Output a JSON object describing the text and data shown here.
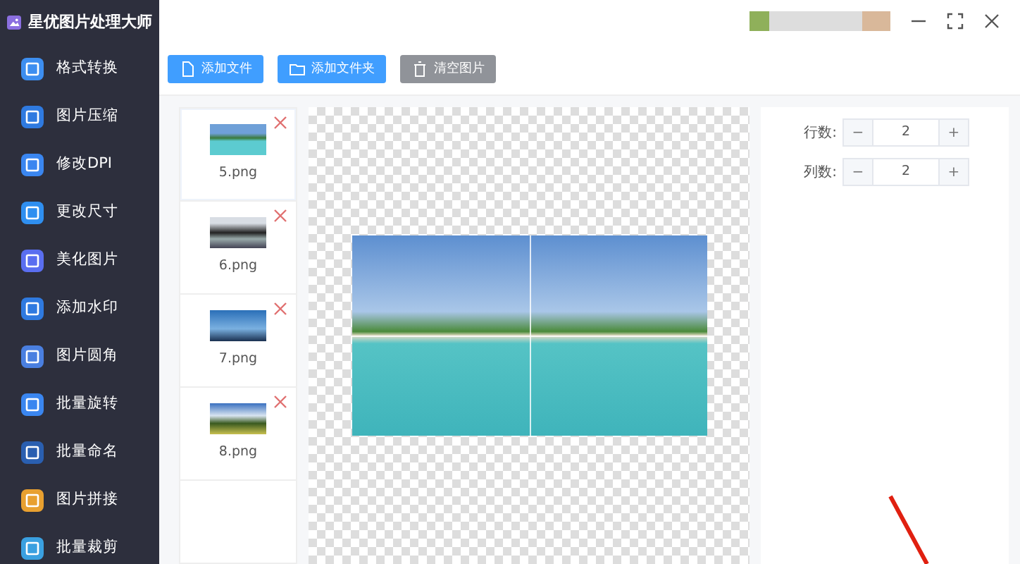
{
  "app": {
    "title": "星优图片处理大师"
  },
  "sidebar": {
    "items": [
      {
        "label": "格式转换",
        "selected": false
      },
      {
        "label": "图片压缩",
        "selected": false
      },
      {
        "label": "修改DPI",
        "selected": false
      },
      {
        "label": "更改尺寸",
        "selected": false
      },
      {
        "label": "美化图片",
        "selected": false
      },
      {
        "label": "添加水印",
        "selected": false
      },
      {
        "label": "图片圆角",
        "selected": false
      },
      {
        "label": "批量旋转",
        "selected": false
      },
      {
        "label": "批量命名",
        "selected": false
      },
      {
        "label": "图片拼接",
        "selected": false
      },
      {
        "label": "批量裁剪",
        "selected": false
      }
    ]
  },
  "toolbar": {
    "buttons": [
      {
        "label": "添加文件",
        "kind": "file",
        "disabled": false
      },
      {
        "label": "添加文件夹",
        "kind": "folder",
        "disabled": false
      },
      {
        "label": "清空图片",
        "kind": "trash",
        "disabled": true
      }
    ]
  },
  "files": [
    {
      "name": "5.png",
      "selected": true
    },
    {
      "name": "6.png",
      "selected": false
    },
    {
      "name": "7.png",
      "selected": false
    },
    {
      "name": "8.png",
      "selected": false
    }
  ],
  "settings": [
    {
      "label": "行数:",
      "value": "2",
      "minus": "−",
      "plus": "+"
    },
    {
      "label": "列数:",
      "value": "2",
      "minus": "−",
      "plus": "+"
    }
  ]
}
